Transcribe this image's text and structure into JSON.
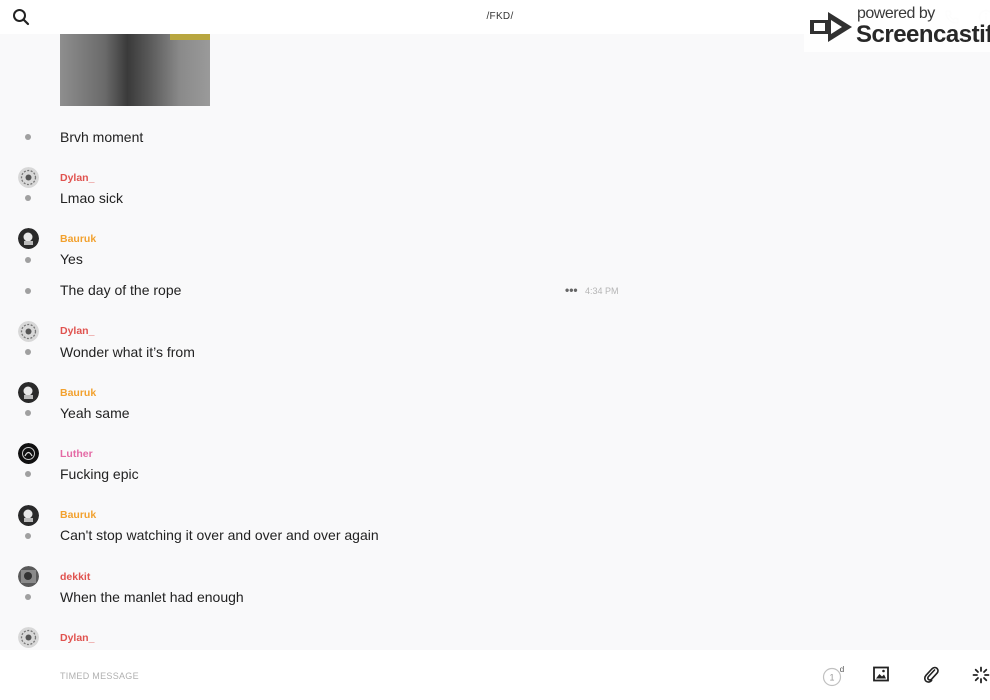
{
  "header": {
    "title": "/FKD/",
    "search_icon": "search-icon",
    "phone_icon": "phone-icon",
    "info_icon": "info-icon"
  },
  "watermark": {
    "small_text": "powered by",
    "brand_text": "Screencastify"
  },
  "messages": [
    {
      "type": "text",
      "text": "Brvh moment"
    },
    {
      "type": "author",
      "author": "Dylan_",
      "color": "#e0534f"
    },
    {
      "type": "text",
      "text": "Lmao sick"
    },
    {
      "type": "author",
      "author": "Bauruk",
      "color": "#f2a12e"
    },
    {
      "type": "text",
      "text": "Yes"
    },
    {
      "type": "text",
      "text": "The day of the rope",
      "time": "4:34 PM"
    },
    {
      "type": "author",
      "author": "Dylan_",
      "color": "#e0534f"
    },
    {
      "type": "text",
      "text": "Wonder what it’s from"
    },
    {
      "type": "author",
      "author": "Bauruk",
      "color": "#f2a12e"
    },
    {
      "type": "text",
      "text": "Yeah same"
    },
    {
      "type": "author",
      "author": "Luther",
      "color": "#e46aa5"
    },
    {
      "type": "text",
      "text": "Fucking epic"
    },
    {
      "type": "author",
      "author": "Bauruk",
      "color": "#f2a12e"
    },
    {
      "type": "text",
      "text": "Can't stop watching it over and over and over again"
    },
    {
      "type": "author",
      "author": "dekkit",
      "color": "#e0534f"
    },
    {
      "type": "text",
      "text": "When the manlet had enough"
    },
    {
      "type": "author",
      "author": "Dylan_",
      "color": "#e0534f"
    }
  ],
  "composer": {
    "placeholder": "TIMED MESSAGE",
    "timer_count": "1",
    "timer_unit": "d",
    "icons": [
      "timer-icon",
      "image-icon",
      "paperclip-icon",
      "sparkle-icon"
    ]
  },
  "colors": {
    "dylan": "#e0534f",
    "bauruk": "#f2a12e",
    "luther": "#e46aa5",
    "dekkit": "#e0534f",
    "bullet": "#a0a0a0"
  }
}
